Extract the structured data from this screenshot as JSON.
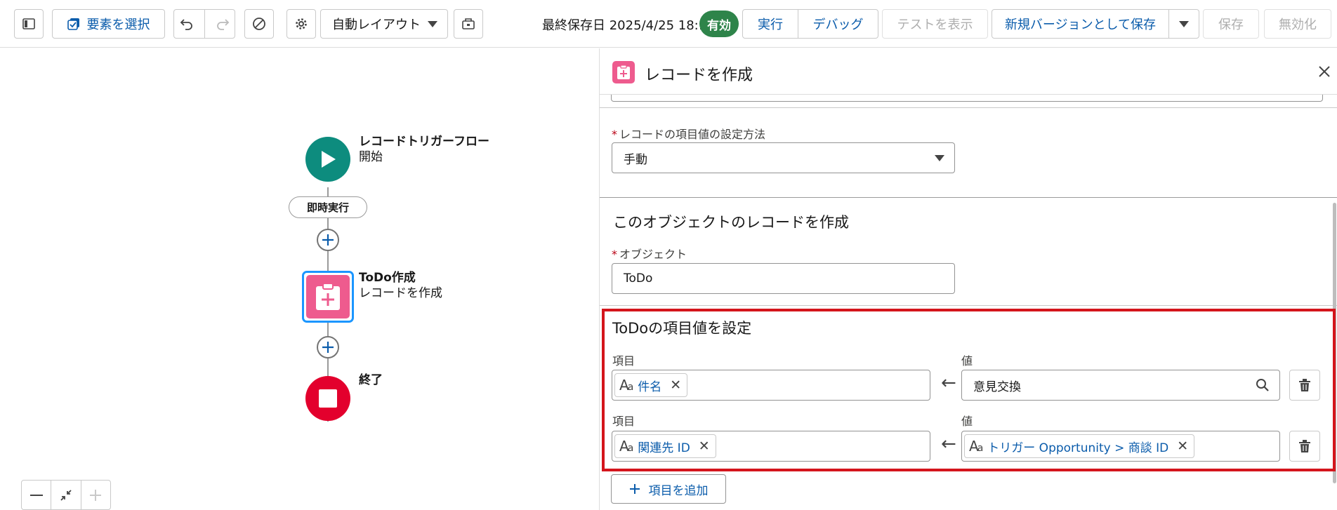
{
  "toolbar": {
    "select_elements_label": "要素を選択",
    "layout_select_value": "自動レイアウト",
    "last_saved_label": "最終保存日 2025/4/25 18:10",
    "status_badge": "有効",
    "run_label": "実行",
    "debug_label": "デバッグ",
    "view_tests_label": "テストを表示",
    "save_as_new_version_label": "新規バージョンとして保存",
    "save_label": "保存",
    "deactivate_label": "無効化"
  },
  "canvas": {
    "start_node": {
      "title": "レコードトリガーフロー",
      "subtitle": "開始"
    },
    "run_immediately_label": "即時実行",
    "create_node": {
      "title": "ToDo作成",
      "subtitle": "レコードを作成"
    },
    "end_node": {
      "title": "終了"
    }
  },
  "panel": {
    "title": "レコードを作成",
    "set_values_method": {
      "label": "レコードの項目値の設定方法",
      "value": "手動"
    },
    "object_section_title": "このオブジェクトのレコードを作成",
    "object": {
      "label": "オブジェクト",
      "value": "ToDo"
    },
    "field_values": {
      "title": "ToDoの項目値を設定",
      "rows": [
        {
          "field_label": "項目",
          "field": "件名",
          "value_label": "値",
          "value": "意見交換"
        },
        {
          "field_label": "項目",
          "field": "関連先 ID",
          "value_label": "値",
          "value": "トリガー Opportunity > 商談 ID"
        }
      ]
    },
    "add_field_label": "項目を追加"
  },
  "colors": {
    "accent": "#0b5cab",
    "active_badge": "#2e844a",
    "start_node": "#0d8c7e",
    "create_node": "#ee5b8e",
    "end_node": "#e3002d",
    "highlight": "#d4151c"
  }
}
